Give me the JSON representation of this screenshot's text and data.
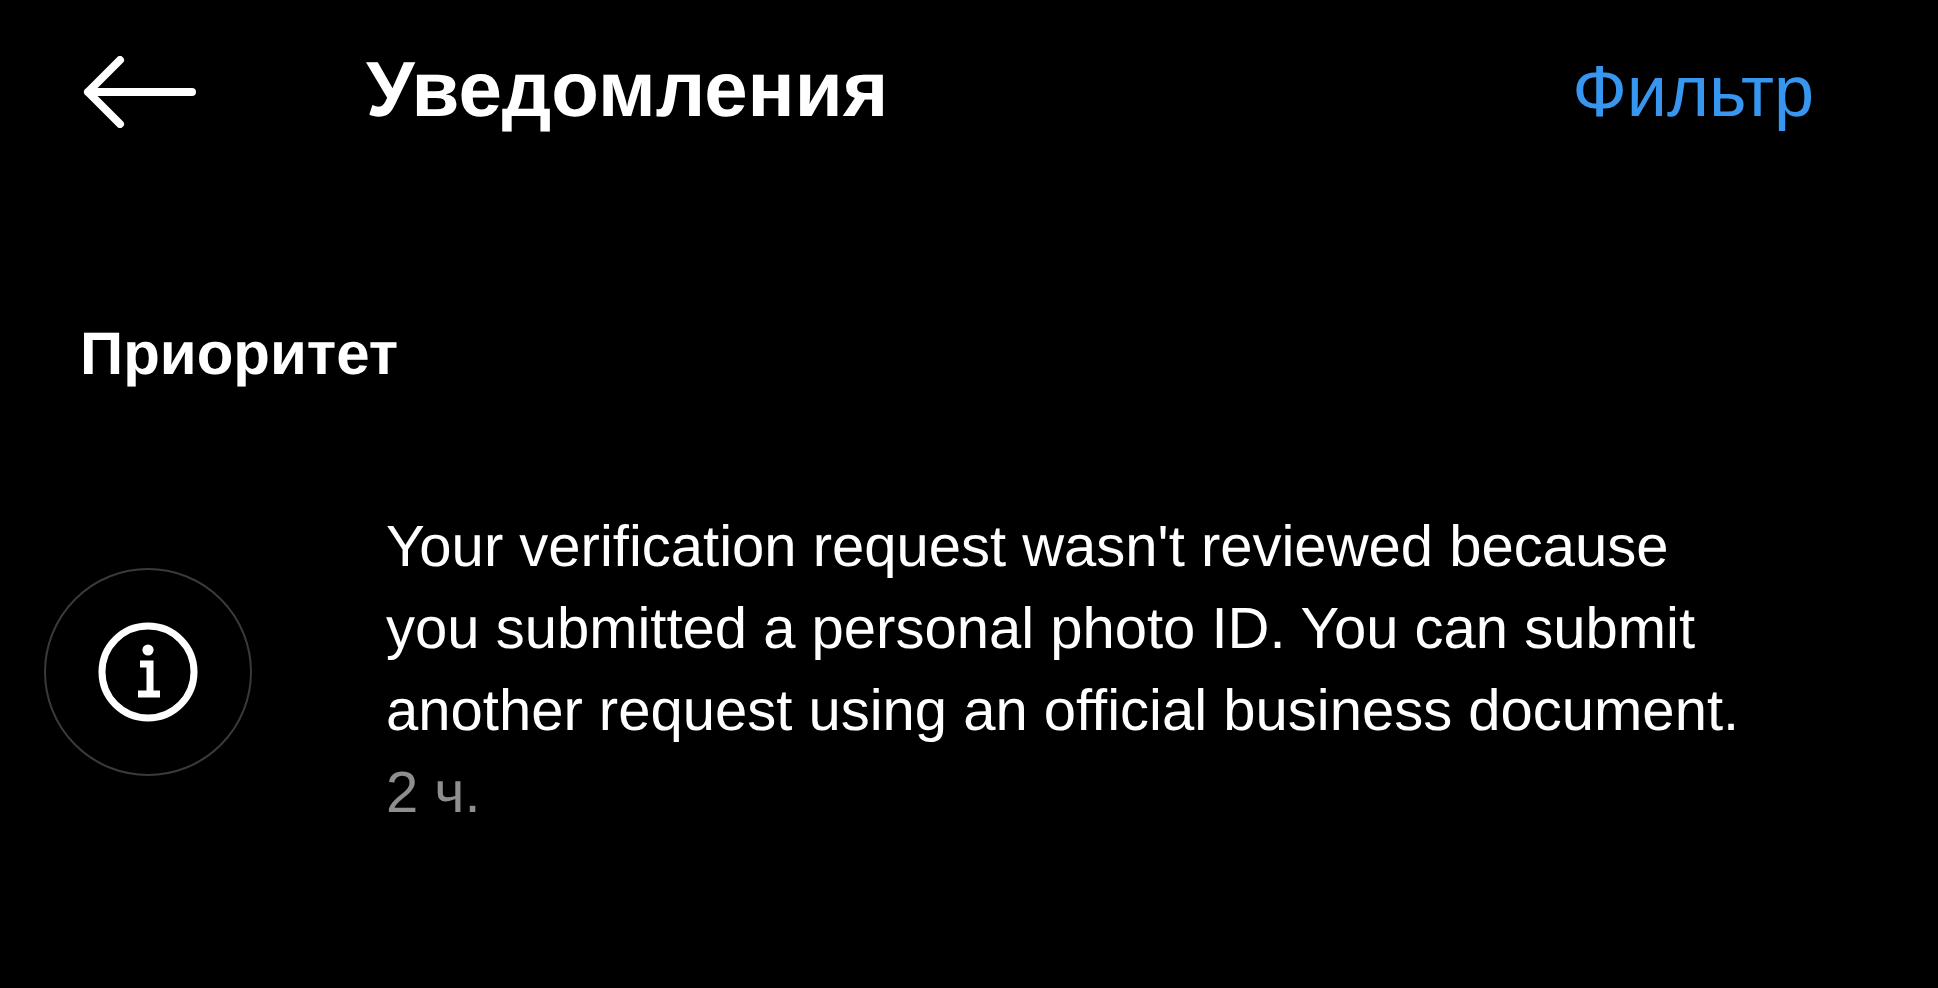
{
  "header": {
    "title": "Уведомления",
    "action": "Фильтр"
  },
  "sections": [
    {
      "title": "Приоритет",
      "notifications": [
        {
          "text": "Your verification request wasn't reviewed because you submitted a personal photo ID. You can submit another request using an official business document.",
          "time": "2 ч."
        }
      ]
    }
  ]
}
